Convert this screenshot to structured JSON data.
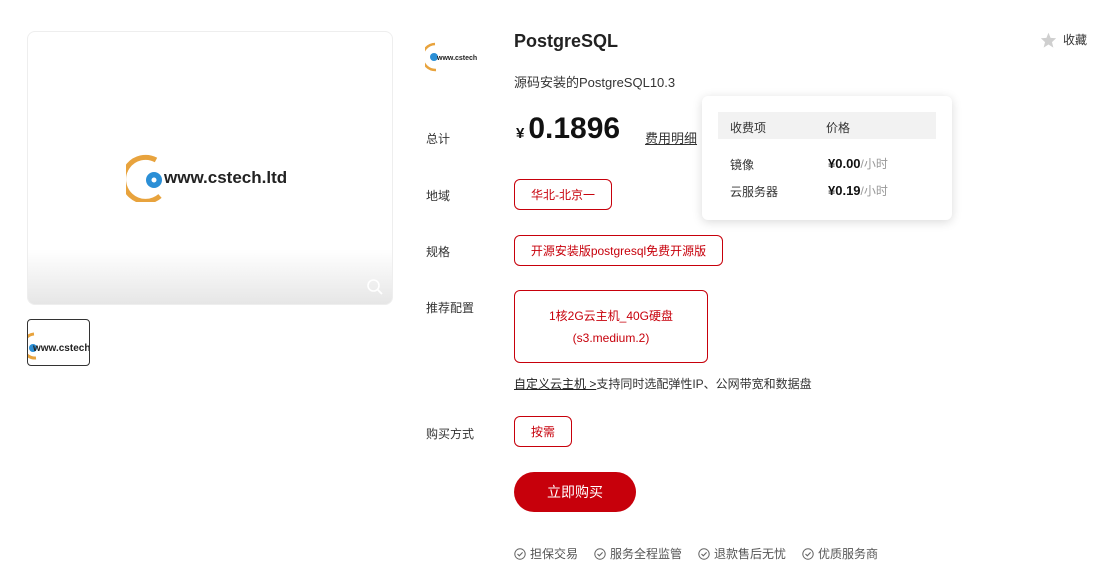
{
  "product": {
    "title": "PostgreSQL",
    "description": "源码安装的PostgreSQL10.3",
    "logo_text": "www.cstech.ltd",
    "thumb_text": "www.cstech"
  },
  "favorite": {
    "label": "收藏",
    "icon": "star-icon"
  },
  "labels": {
    "total": "总计",
    "region": "地域",
    "spec": "规格",
    "recommended": "推荐配置",
    "purchase_mode": "购买方式"
  },
  "price": {
    "currency": "¥",
    "amount": "0.1896",
    "fee_detail_link": "费用明细"
  },
  "options": {
    "region": "华北-北京一",
    "spec": "开源安装版postgresql免费开源版",
    "config_line1": "1核2G云主机_40G硬盘",
    "config_line2": "(s3.medium.2)",
    "purchase_mode": "按需"
  },
  "custom": {
    "link": "自定义云主机 >",
    "text": "支持同时选配弹性IP、公网带宽和数据盘"
  },
  "buy_button": "立即购买",
  "guarantees": [
    "担保交易",
    "服务全程监管",
    "退款售后无忧",
    "优质服务商"
  ],
  "fee_popover": {
    "headers": [
      "收费项",
      "价格"
    ],
    "rows": [
      {
        "item": "镜像",
        "price": "¥0.00",
        "unit": "/小时"
      },
      {
        "item": "云服务器",
        "price": "¥0.19",
        "unit": "/小时"
      }
    ]
  },
  "colors": {
    "accent": "#c7000b",
    "logo_orange": "#e8a33d",
    "logo_blue": "#2b8fd6"
  }
}
